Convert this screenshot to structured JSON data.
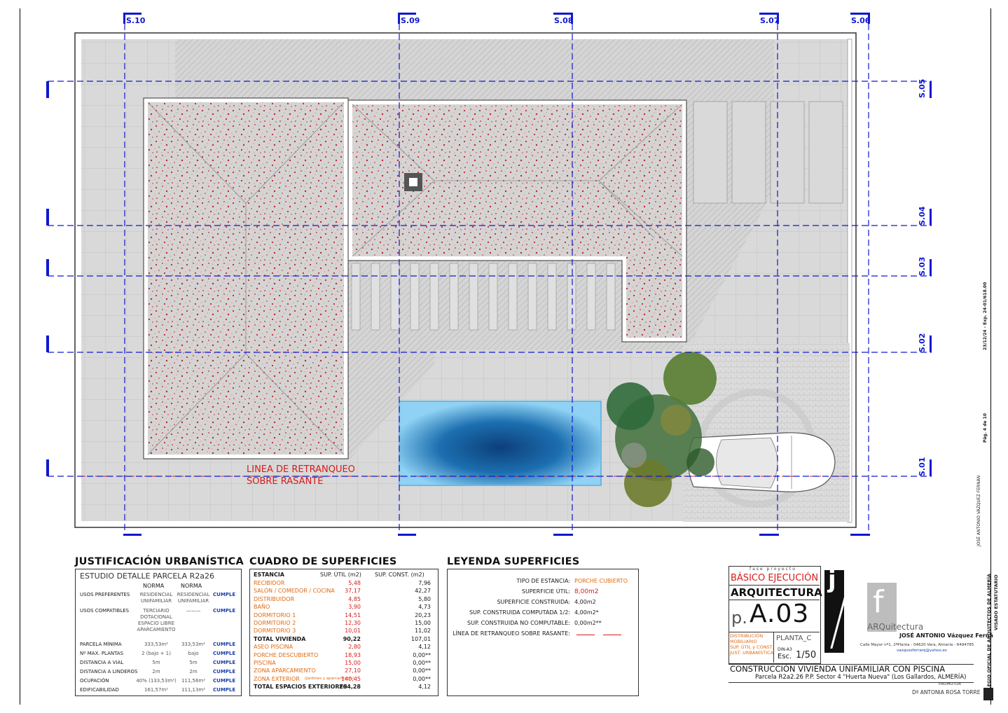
{
  "grid": {
    "columns": [
      "S.10",
      "S.09",
      "S.08",
      "S.07",
      "S.06"
    ],
    "rows": [
      "S.05",
      "S.04",
      "S.03",
      "S.02",
      "S.01"
    ]
  },
  "plan": {
    "setback_line": [
      "LINEA DE RETRANQUEO",
      "SOBRE RASANTE"
    ],
    "colors": {
      "grid": "#1018d0",
      "setback": "#d81b1b",
      "roof_dots": "#c0272d",
      "pool": "#1c6fb0"
    }
  },
  "justificacion": {
    "title": "JUSTIFICACIÓN URBANÍSTICA",
    "subtitle": "ESTUDIO DETALLE PARCELA R2a26",
    "col_headers": [
      "NORMA",
      "NORMA"
    ],
    "rows": [
      {
        "label": "USOS PREFERENTES",
        "a": "RESIDENCIAL UNIFAMILIAR",
        "b": "RESIDENCIAL UNIFAMILIAR",
        "status": "CUMPLE"
      },
      {
        "label": "USOS COMPATIBLES",
        "a": "TERCIARIO DOTACIONAL ESPACIO LIBRE APARCAMIENTO",
        "b": "———",
        "status": "CUMPLE"
      },
      {
        "label": "PARCELA MÍNIMA",
        "a": "333,53m²",
        "b": "333,53m²",
        "status": "CUMPLE"
      },
      {
        "label": "Nº MAX. PLANTAS",
        "a": "2 (bajo + 1)",
        "b": "bajo",
        "status": "CUMPLE"
      },
      {
        "label": "DISTANCIA A VIAL",
        "a": "5m",
        "b": "5m",
        "status": "CUMPLE"
      },
      {
        "label": "DISTANCIA A LINDEROS",
        "a": "2m",
        "b": "2m",
        "status": "CUMPLE"
      },
      {
        "label": "OCUPACIÓN",
        "a": "40% (133,53m²)",
        "b": "111,56m²",
        "status": "CUMPLE"
      },
      {
        "label": "EDIFICABILIDAD",
        "a": "161,57m²",
        "b": "111,13m²",
        "status": "CUMPLE"
      }
    ]
  },
  "cuadro": {
    "title": "CUADRO DE SUPERFICIES",
    "headers": [
      "ESTANCIA",
      "SUP. ÚTIL (m2)",
      "SUP. CONST. (m2)"
    ],
    "rows": [
      {
        "name": "RECIBIDOR",
        "util": "5,48",
        "const": "7,96",
        "type": "room"
      },
      {
        "name": "SALÓN / COMEDOR / COCINA",
        "util": "37,17",
        "const": "42,27",
        "type": "room"
      },
      {
        "name": "DISTRIBUIDOR",
        "util": "4,85",
        "const": "5,80",
        "type": "room"
      },
      {
        "name": "BAÑO",
        "util": "3,90",
        "const": "4,73",
        "type": "room"
      },
      {
        "name": "DORMITORIO 1",
        "util": "14,51",
        "const": "20,23",
        "type": "room"
      },
      {
        "name": "DORMITORIO 2",
        "util": "12,30",
        "const": "15,00",
        "type": "room"
      },
      {
        "name": "DORMITORIO 3",
        "util": "10,01",
        "const": "11,02",
        "type": "room"
      },
      {
        "name": "TOTAL VIVIENDA",
        "util": "90,22",
        "const": "107,01",
        "type": "total"
      },
      {
        "name": "ASEO PISCINA",
        "util": "2,80",
        "const": "4,12",
        "type": "ext"
      },
      {
        "name": "PORCHE DESCUBIERTO",
        "util": "18,93",
        "const": "0,00**",
        "type": "ext"
      },
      {
        "name": "PISCINA",
        "util": "15,00",
        "const": "0,00**",
        "type": "ext"
      },
      {
        "name": "ZONA APARCAMIENTO",
        "util": "27,10",
        "const": "0,00**",
        "type": "ext"
      },
      {
        "name": "ZONA EXTERIOR",
        "note": "(Jardines y aparcamiento)",
        "util": "140,45",
        "const": "0,00**",
        "type": "ext"
      },
      {
        "name": "TOTAL ESPACIOS EXTERIORES",
        "util": "204,28",
        "const": "4,12",
        "type": "total"
      }
    ]
  },
  "leyenda": {
    "title": "LEYENDA SUPERFICIES",
    "rows": [
      {
        "label": "TIPO DE ESTANCIA:",
        "value": "PORCHE CUBIERTO",
        "style": "orange"
      },
      {
        "label": "SUPERFICIE ÚTIL:",
        "value": "8,00m2",
        "style": "red"
      },
      {
        "label": "SUPERFICIE CONSTRUIDA:",
        "value": "4,00m2",
        "style": "plain"
      },
      {
        "label": "SUP. CONSTRUIDA COMPUTADA 1/2:",
        "value": "4,00m2*",
        "style": "plain"
      },
      {
        "label": "SUP. CONSTRUIDA NO COMPUTABLE:",
        "value": "0,00m2**",
        "style": "plain"
      },
      {
        "label": "LÍNEA DE RETRANQUEO SOBRE RASANTE:",
        "value": "",
        "style": "line"
      }
    ]
  },
  "titleblock": {
    "fase": "fase proyecto",
    "fase_value": "BÁSICO EJECUCIÓN",
    "discipline": "ARQUITECTURA",
    "sheet_prefix": "p.",
    "sheet_number": "A.03",
    "sheet_desc": [
      "DISTRIBUCIÓN",
      "MOBILIARIO",
      "SUP. ÚTIL y CONST.",
      "JUST. URBANÍSTICA"
    ],
    "plan_name": "PLANTA_C",
    "format": "DIN-A3",
    "scale_label": "Esc.",
    "scale": "1/50",
    "logo_left": "j",
    "logo_right": "f",
    "logo_text": "ARQuitectura",
    "architect": "JOSÉ ANTONIO Vázquez Ferná",
    "address": "Calle Mayor nº1, 2ªPlanta - 04620 Vera, Almería - 6494785",
    "email": "vazquezferrarq@yahoo.es",
    "project_title": "CONSTRUCCIÓN VIVIENDA UNIFAMILIAR CON PISCINA",
    "project_site": "Parcela R2a2.26 P.P. Sector 4 \"Huerta Nueva\" (Los Gallardos, ALMERÍA)",
    "promotor_label": "PROMOTOR",
    "promotor": "Dª ANTONIA ROSA TORRE",
    "side_notes": [
      "JOSÉ ANTONIO VÁZQUEZ FERNÁN",
      "Pág. 4 de 10",
      "23/12/24 - Exp. 24-01/618.00",
      "COLEGIO OFICIAL DE ARQUITECTOS DE ALMERÍA",
      "VISADO ESTATUTARIO"
    ]
  }
}
